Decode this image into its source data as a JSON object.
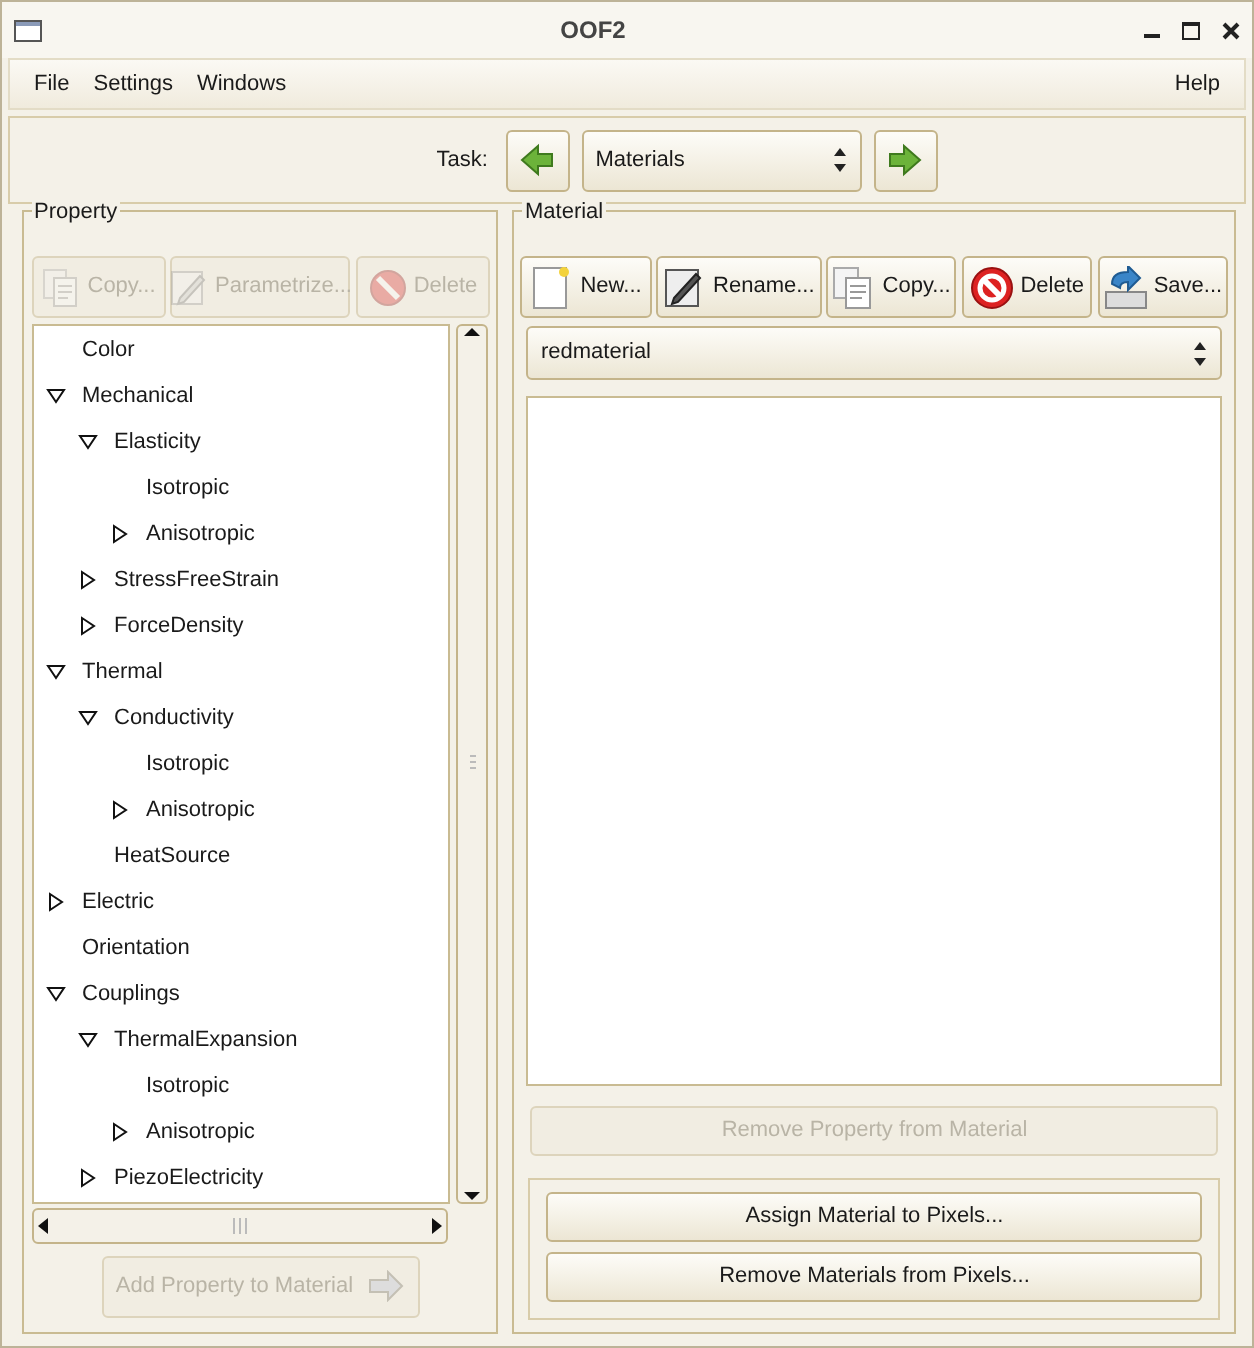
{
  "window": {
    "title": "OOF2"
  },
  "menu": {
    "left": [
      "File",
      "Settings",
      "Windows"
    ],
    "right": [
      "Help"
    ]
  },
  "task": {
    "label": "Task:",
    "value": "Materials"
  },
  "property": {
    "title": "Property",
    "buttons": [
      {
        "label": "Copy...",
        "disabled": true
      },
      {
        "label": "Parametrize...",
        "disabled": true
      },
      {
        "label": "Delete",
        "disabled": true
      }
    ],
    "tree": [
      {
        "label": "Color"
      },
      {
        "label": "Mechanical",
        "expanded": true,
        "children": [
          {
            "label": "Elasticity",
            "expanded": true,
            "children": [
              {
                "label": "Isotropic"
              },
              {
                "label": "Anisotropic",
                "expanded": false
              }
            ]
          },
          {
            "label": "StressFreeStrain",
            "expanded": false
          },
          {
            "label": "ForceDensity",
            "expanded": false
          }
        ]
      },
      {
        "label": "Thermal",
        "expanded": true,
        "children": [
          {
            "label": "Conductivity",
            "expanded": true,
            "children": [
              {
                "label": "Isotropic"
              },
              {
                "label": "Anisotropic",
                "expanded": false
              }
            ]
          },
          {
            "label": "HeatSource"
          }
        ]
      },
      {
        "label": "Electric",
        "expanded": false
      },
      {
        "label": "Orientation"
      },
      {
        "label": "Couplings",
        "expanded": true,
        "children": [
          {
            "label": "ThermalExpansion",
            "expanded": true,
            "children": [
              {
                "label": "Isotropic"
              },
              {
                "label": "Anisotropic",
                "expanded": false
              }
            ]
          },
          {
            "label": "PiezoElectricity",
            "expanded": false
          }
        ]
      }
    ],
    "add_button": {
      "label": "Add Property to Material",
      "disabled": true
    }
  },
  "material": {
    "title": "Material",
    "buttons": [
      {
        "label": "New...",
        "disabled": false
      },
      {
        "label": "Rename...",
        "disabled": false
      },
      {
        "label": "Copy...",
        "disabled": false
      },
      {
        "label": "Delete",
        "disabled": false
      },
      {
        "label": "Save...",
        "disabled": false
      }
    ],
    "selected": "redmaterial",
    "remove_property": {
      "label": "Remove Property from Material",
      "disabled": true
    },
    "pixel_buttons": [
      {
        "label": "Assign Material to Pixels...",
        "disabled": false
      },
      {
        "label": "Remove Materials from Pixels...",
        "disabled": false
      }
    ]
  }
}
